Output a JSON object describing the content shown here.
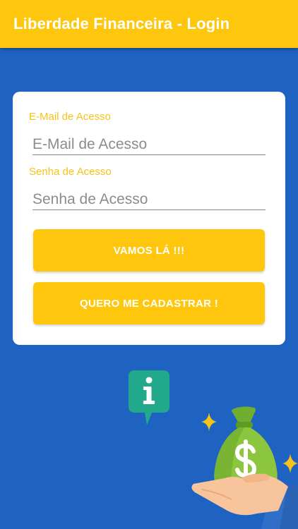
{
  "appbar": {
    "title": "Liberdade Financeira - Login"
  },
  "login_form": {
    "email": {
      "label": "E-Mail de Acesso",
      "placeholder": "E-Mail de Acesso",
      "value": ""
    },
    "password": {
      "label": "Senha de Acesso",
      "placeholder": "Senha de Acesso",
      "value": ""
    },
    "submit_label": "VAMOS LÁ !!!",
    "register_label": "QUERO ME CADASTRAR !"
  },
  "illustration": {
    "icons": [
      "info-bubble-icon",
      "sparkle-icon",
      "money-bag-icon",
      "dollar-sign-icon",
      "hand-icon"
    ],
    "colors": {
      "bubble": "#22a98b",
      "bag": "#8cc63e",
      "sparkle": "#f7c21a",
      "hand": "#f8c49b",
      "sleeve": "#2f6fc7"
    }
  },
  "colors": {
    "background": "#1f63c2",
    "accent": "#fec70d",
    "card": "#ffffff"
  }
}
